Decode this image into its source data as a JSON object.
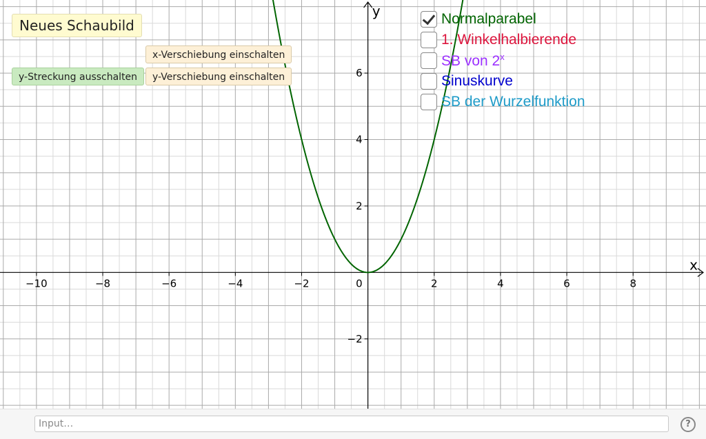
{
  "buttons": {
    "new_graph": "Neues Schaubild",
    "x_shift": "x-Verschiebung einschalten",
    "y_shift": "y-Verschiebung einschalten",
    "y_stretch": "y-Streckung ausschalten"
  },
  "checkboxes": [
    {
      "label": "Normalparabel",
      "checked": true,
      "color": "#006400"
    },
    {
      "label": "1. Winkelhalbierende",
      "checked": false,
      "color": "#dc143c"
    },
    {
      "label_base": "SB von 2",
      "label_sup": "x",
      "checked": false,
      "color": "#9b30ff"
    },
    {
      "label": "Sinuskurve",
      "checked": false,
      "color": "#0000cd"
    },
    {
      "label": "SB der Wurzelfunktion",
      "checked": false,
      "color": "#1e9bc8"
    }
  ],
  "axes": {
    "x_label": "x",
    "y_label": "y",
    "x_ticks": [
      -10,
      -8,
      -6,
      -4,
      -2,
      2,
      4,
      6,
      8
    ],
    "y_ticks": [
      -2,
      2,
      4,
      6
    ],
    "origin_label": "0",
    "xlim": [
      -11.1,
      10.2
    ],
    "ylim": [
      -4.1,
      8.2
    ]
  },
  "grid": {
    "minor_step": 0.5,
    "major_step": 1,
    "minor_color": "#d9d9d9",
    "major_color": "#a9a9a9"
  },
  "curve": {
    "name": "Normalparabel",
    "function": "x^2",
    "color": "#006400"
  },
  "input_bar": {
    "placeholder": "Input…"
  },
  "help_icon": {
    "glyph": "?"
  }
}
